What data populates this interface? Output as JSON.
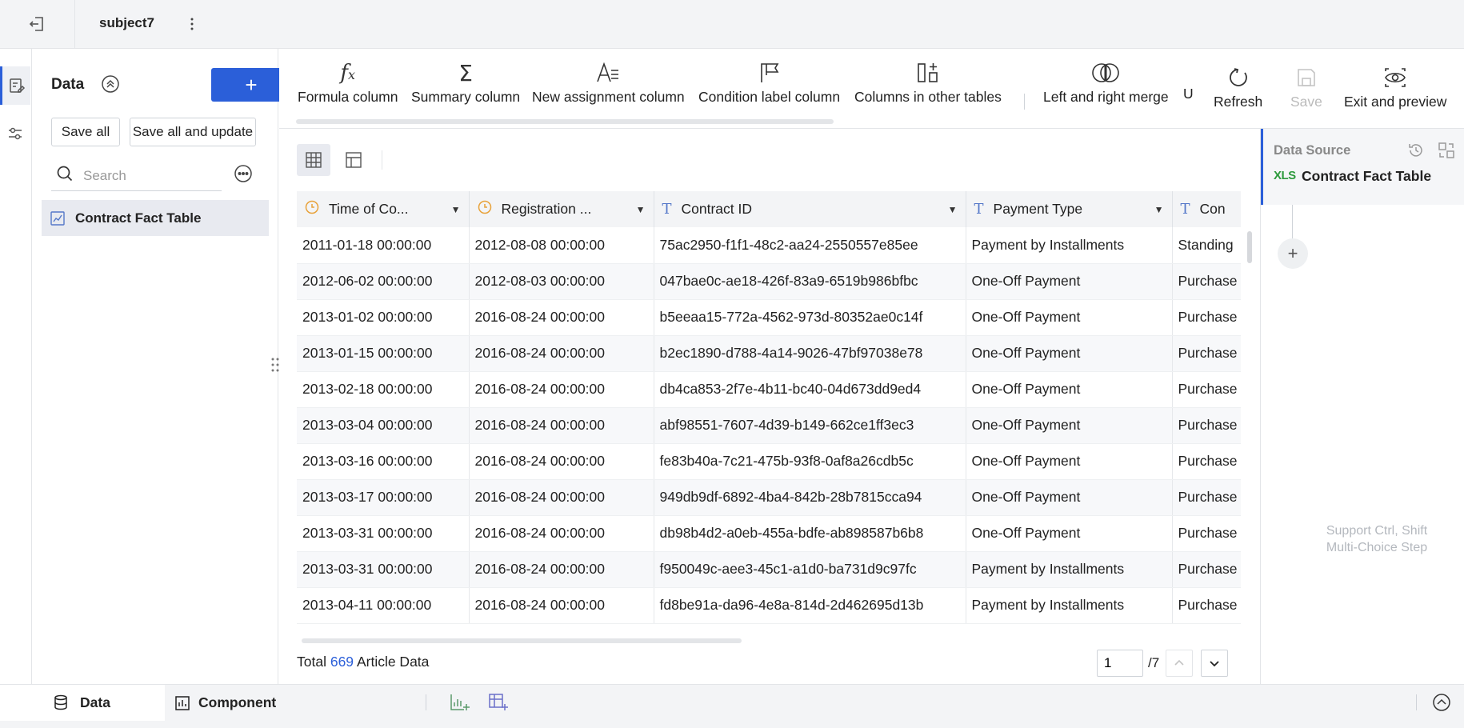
{
  "header": {
    "subject_name": "subject7"
  },
  "data_panel": {
    "title": "Data",
    "add_label": "+",
    "save_all_label": "Save all",
    "save_all_update_label": "Save all and update",
    "search_placeholder": "Search",
    "tables": [
      {
        "name": "Contract Fact Table"
      }
    ],
    "active_table": "Contract Fact Table"
  },
  "toolbar": {
    "formula_column": "Formula column",
    "summary_column": "Summary column",
    "new_assignment_column": "New assignment column",
    "condition_label_column": "Condition label column",
    "columns_in_other_tables": "Columns in other tables",
    "left_right_merge": "Left and right merge",
    "truncated": "U",
    "refresh": "Refresh",
    "save": "Save",
    "exit_preview": "Exit and preview"
  },
  "grid": {
    "columns": [
      {
        "name": "Time of Co...",
        "type": "time"
      },
      {
        "name": "Registration ...",
        "type": "time"
      },
      {
        "name": "Contract ID",
        "type": "text"
      },
      {
        "name": "Payment Type",
        "type": "text"
      },
      {
        "name": "Con",
        "type": "text"
      }
    ],
    "rows": [
      [
        "2011-01-18 00:00:00",
        "2012-08-08 00:00:00",
        "75ac2950-f1f1-48c2-aa24-2550557e85ee",
        "Payment by Installments",
        "Standing"
      ],
      [
        "2012-06-02 00:00:00",
        "2012-08-03 00:00:00",
        "047bae0c-ae18-426f-83a9-6519b986bfbc",
        "One-Off Payment",
        "Purchase"
      ],
      [
        "2013-01-02 00:00:00",
        "2016-08-24 00:00:00",
        "b5eeaa15-772a-4562-973d-80352ae0c14f",
        "One-Off Payment",
        "Purchase"
      ],
      [
        "2013-01-15 00:00:00",
        "2016-08-24 00:00:00",
        "b2ec1890-d788-4a14-9026-47bf97038e78",
        "One-Off Payment",
        "Purchase"
      ],
      [
        "2013-02-18 00:00:00",
        "2016-08-24 00:00:00",
        "db4ca853-2f7e-4b11-bc40-04d673dd9ed4",
        "One-Off Payment",
        "Purchase"
      ],
      [
        "2013-03-04 00:00:00",
        "2016-08-24 00:00:00",
        "abf98551-7607-4d39-b149-662ce1ff3ec3",
        "One-Off Payment",
        "Purchase"
      ],
      [
        "2013-03-16 00:00:00",
        "2016-08-24 00:00:00",
        "fe83b40a-7c21-475b-93f8-0af8a26cdb5c",
        "One-Off Payment",
        "Purchase"
      ],
      [
        "2013-03-17 00:00:00",
        "2016-08-24 00:00:00",
        "949db9df-6892-4ba4-842b-28b7815cca94",
        "One-Off Payment",
        "Purchase"
      ],
      [
        "2013-03-31 00:00:00",
        "2016-08-24 00:00:00",
        "db98b4d2-a0eb-455a-bdfe-ab898587b6b8",
        "One-Off Payment",
        "Purchase"
      ],
      [
        "2013-03-31 00:00:00",
        "2016-08-24 00:00:00",
        "f950049c-aee3-45c1-a1d0-ba731d9c97fc",
        "Payment by Installments",
        "Purchase"
      ],
      [
        "2013-04-11 00:00:00",
        "2016-08-24 00:00:00",
        "fd8be91a-da96-4e8a-814d-2d462695d13b",
        "Payment by Installments",
        "Purchase"
      ]
    ],
    "footer": {
      "total_prefix": "Total",
      "total_count": "669",
      "total_suffix": "Article Data",
      "page_value": "1",
      "page_total": "/7"
    }
  },
  "right_panel": {
    "step_title": "Data Source",
    "xls_badge": "XLS",
    "step_table": "Contract Fact Table",
    "add_step": "+",
    "hint_line1": "Support Ctrl, Shift",
    "hint_line2": "Multi-Choice Step"
  },
  "bottom_tabs": {
    "data": "Data",
    "component": "Component"
  },
  "colors": {
    "accent": "#2b5fd9",
    "time_icon": "#e8a23a",
    "text_icon": "#5578c9",
    "xls": "#2e9a3d"
  }
}
